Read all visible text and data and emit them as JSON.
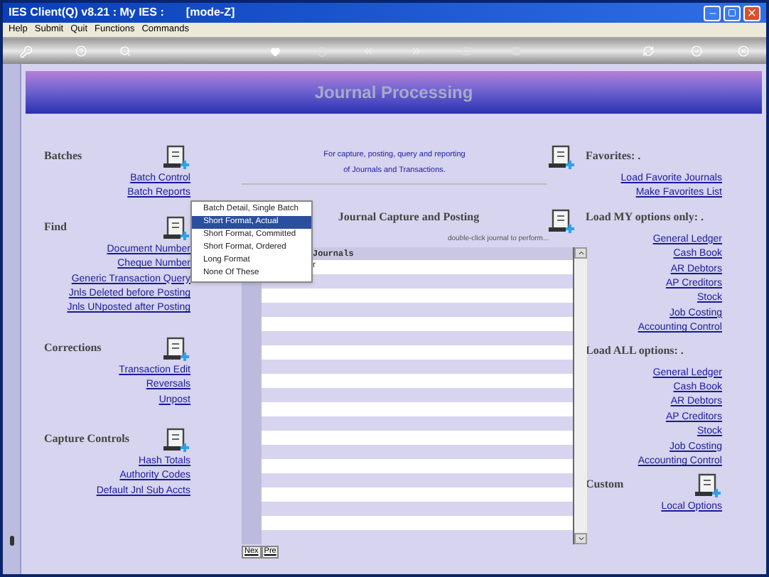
{
  "window": {
    "title": "IES Client(Q) v8.21 : My IES :       [mode-Z]"
  },
  "menu": [
    "Help",
    "Submit",
    "Quit",
    "Functions",
    "Commands"
  ],
  "banner": {
    "title": "Journal Processing"
  },
  "left_sections": [
    {
      "title": "Batches",
      "links": [
        "Batch Control",
        "Batch Reports"
      ]
    },
    {
      "title": "Find",
      "links": [
        "Document Number",
        "Cheque Number",
        "Generic Transaction Query",
        "Jnls Deleted before Posting",
        "Jnls UNposted after Posting"
      ]
    },
    {
      "title": "Corrections",
      "links": [
        "Transaction Edit",
        "Reversals",
        "Unpost"
      ]
    },
    {
      "title": "Capture Controls",
      "links": [
        "Hash Totals",
        "Authority Codes",
        "Default Jnl Sub Accts"
      ]
    }
  ],
  "intro": [
    "For capture, posting, query and reporting",
    "of Journals and Transactions."
  ],
  "capture": {
    "title": "Journal Capture and Posting",
    "hint": "double-click journal to perform...",
    "list_header": "Journals",
    "rows": [
      "r"
    ],
    "buttons": [
      "Nex",
      "Pre"
    ]
  },
  "right_sections": [
    {
      "title": "Favorites: .",
      "links": [
        "Load Favorite Journals",
        "Make Favorites List"
      ]
    },
    {
      "title": "Load MY options only: .",
      "links": [
        "General Ledger",
        "Cash Book",
        "AR Debtors",
        "AP Creditors",
        "Stock",
        "Job Costing",
        "Accounting Control"
      ]
    },
    {
      "title": "Load ALL options: .",
      "links": [
        "General Ledger",
        "Cash Book",
        "AR Debtors",
        "AP Creditors",
        "Stock",
        "Job Costing",
        "Accounting Control"
      ]
    },
    {
      "title": "Custom",
      "links": [
        "Local Options"
      ]
    }
  ],
  "popup_menu": [
    {
      "label": "Batch Detail, Single Batch",
      "selected": false
    },
    {
      "label": "Short Format, Actual",
      "selected": true
    },
    {
      "label": "Short Format, Committed",
      "selected": false
    },
    {
      "label": "Short Format, Ordered",
      "selected": false
    },
    {
      "label": "Long Format",
      "selected": false
    },
    {
      "label": "None Of These",
      "selected": false
    }
  ]
}
